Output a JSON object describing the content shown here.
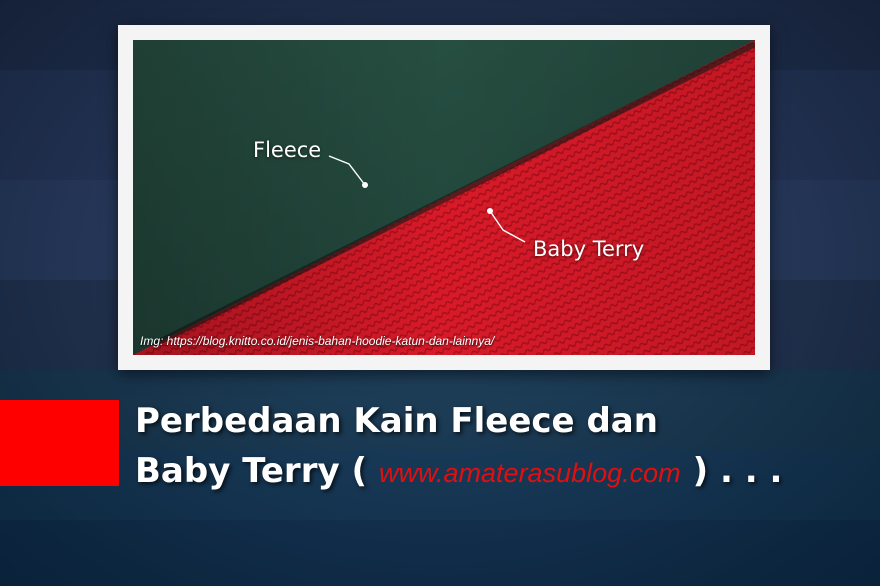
{
  "photo": {
    "label_fleece": "Fleece",
    "label_baby_terry": "Baby Terry",
    "credit": "Img: https://blog.knitto.co.id/jenis-bahan-hoodie-katun-dan-lainnya/"
  },
  "headline": {
    "line1": "Perbedaan Kain Fleece dan",
    "line2_prefix": "Baby Terry (",
    "site": "www.amaterasublog.com",
    "line2_suffix": ") . . ."
  },
  "colors": {
    "accent_red": "#ff0000",
    "fleece_green": "#23493f",
    "terry_red": "#d81a28",
    "site_red": "#e01010"
  }
}
